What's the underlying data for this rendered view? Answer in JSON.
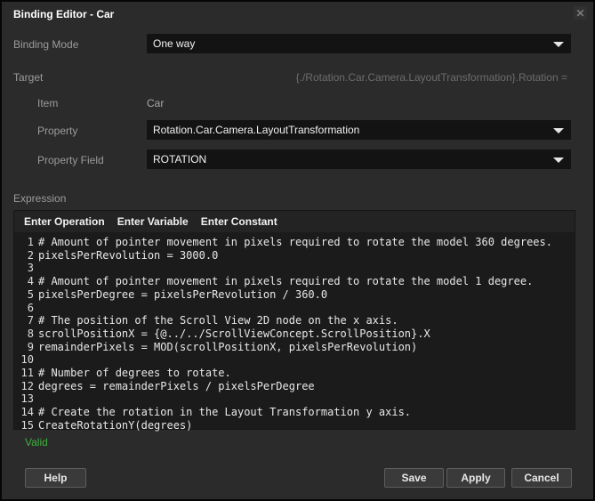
{
  "window": {
    "title": "Binding Editor - Car",
    "close_icon": "✕"
  },
  "binding_mode": {
    "label": "Binding Mode",
    "value": "One way"
  },
  "target": {
    "label": "Target",
    "preview": "{./Rotation.Car.Camera.LayoutTransformation}.Rotation =",
    "item": {
      "label": "Item",
      "value": "Car"
    },
    "property": {
      "label": "Property",
      "value": "Rotation.Car.Camera.LayoutTransformation"
    },
    "property_field": {
      "label": "Property Field",
      "value": "ROTATION"
    }
  },
  "expression": {
    "label": "Expression",
    "toolbar": [
      "Enter Operation",
      "Enter Variable",
      "Enter Constant"
    ],
    "lines": [
      "# Amount of pointer movement in pixels required to rotate the model 360 degrees.",
      "pixelsPerRevolution = 3000.0",
      "",
      "# Amount of pointer movement in pixels required to rotate the model 1 degree.",
      "pixelsPerDegree = pixelsPerRevolution / 360.0",
      "",
      "# The position of the Scroll View 2D node on the x axis.",
      "scrollPositionX = {@../../ScrollViewConcept.ScrollPosition}.X",
      "remainderPixels = MOD(scrollPositionX, pixelsPerRevolution)",
      "",
      "# Number of degrees to rotate.",
      "degrees = remainderPixels / pixelsPerDegree",
      "",
      "# Create the rotation in the Layout Transformation y axis.",
      "CreateRotationY(degrees)"
    ],
    "status": "Valid"
  },
  "footer": {
    "help": "Help",
    "save": "Save",
    "apply": "Apply",
    "cancel": "Cancel"
  },
  "colors": {
    "dialog_bg": "#2b2b2b",
    "field_bg": "#131313",
    "editor_bg": "#1b1b1b",
    "valid_green": "#3faf3f",
    "label_gray": "#9b9b9b",
    "preview_gray": "#6d6d6d"
  }
}
